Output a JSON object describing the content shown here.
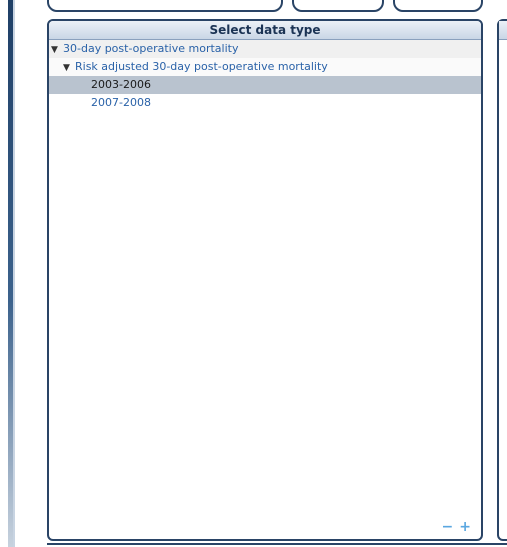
{
  "panel": {
    "title": "Select data type"
  },
  "tree": {
    "level1": {
      "arrow": "▼",
      "label": "30-day post-operative mortality"
    },
    "level2": {
      "arrow": "▼",
      "label": "Risk adjusted 30-day post-operative mortality"
    },
    "items": [
      {
        "label": "2003-2006",
        "selected": true
      },
      {
        "label": "2007-2008",
        "selected": false
      }
    ]
  },
  "zoom": {
    "minus": "−",
    "plus": "+"
  },
  "colors": {
    "border": "#2a4466",
    "link": "#2a62a8",
    "selected_bg": "#b9c3cf",
    "zoom": "#5aa7e0"
  }
}
